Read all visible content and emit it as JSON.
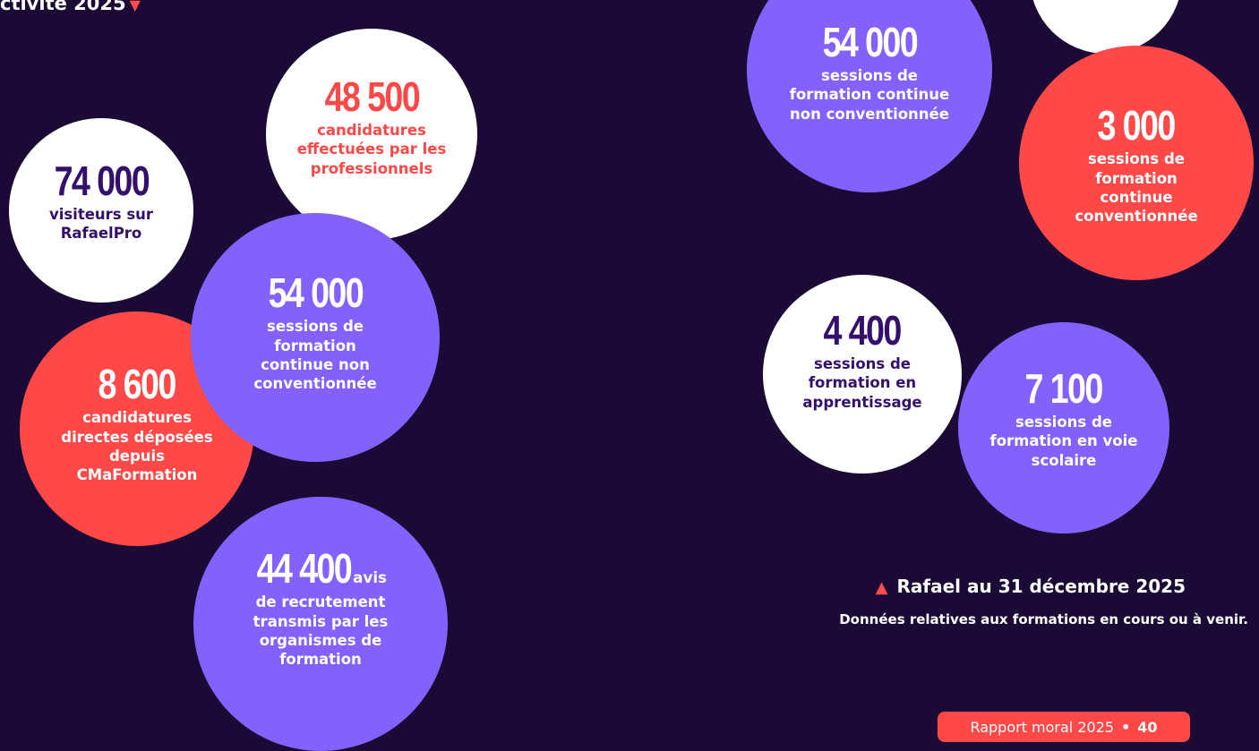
{
  "header": {
    "label": "ctivité 2025"
  },
  "stats": {
    "candidatures_pro": {
      "number": "48 500",
      "text": "candidatures effectuées par les professionnels"
    },
    "visiteurs": {
      "number": "74 000",
      "text": "visiteurs sur RafaelPro"
    },
    "sessions_cont_left": {
      "number": "54 000",
      "text": "sessions de formation continue non conventionnée"
    },
    "candidatures_cma": {
      "number": "8 600",
      "text": "candidatures directes déposées depuis CMaFormation"
    },
    "avis": {
      "number": "44 400",
      "suffix": "avis",
      "text": "de recrutement transmis par les organismes de formation"
    },
    "sessions_cont_right": {
      "number": "54 000",
      "text": "sessions de formation continue non conventionnée"
    },
    "sessions_conv": {
      "number": "3 000",
      "text": "sessions de formation continue conventionnée"
    },
    "sessions_app": {
      "number": "4 400",
      "text": "sessions de formation en apprentissage"
    },
    "sessions_scol": {
      "number": "7 100",
      "text": "sessions de formation en voie scolaire"
    }
  },
  "footnote": {
    "title": "Rafael au 31 décembre 2025",
    "subtitle": "Données relatives aux formations en cours ou à venir."
  },
  "footer": {
    "report": "Rapport moral 2025",
    "separator": "•",
    "page": "40"
  },
  "colors": {
    "background": "#1c0a36",
    "violet": "#8361fd",
    "red": "#ff4848",
    "dark_text": "#33106b",
    "white": "#ffffff"
  }
}
